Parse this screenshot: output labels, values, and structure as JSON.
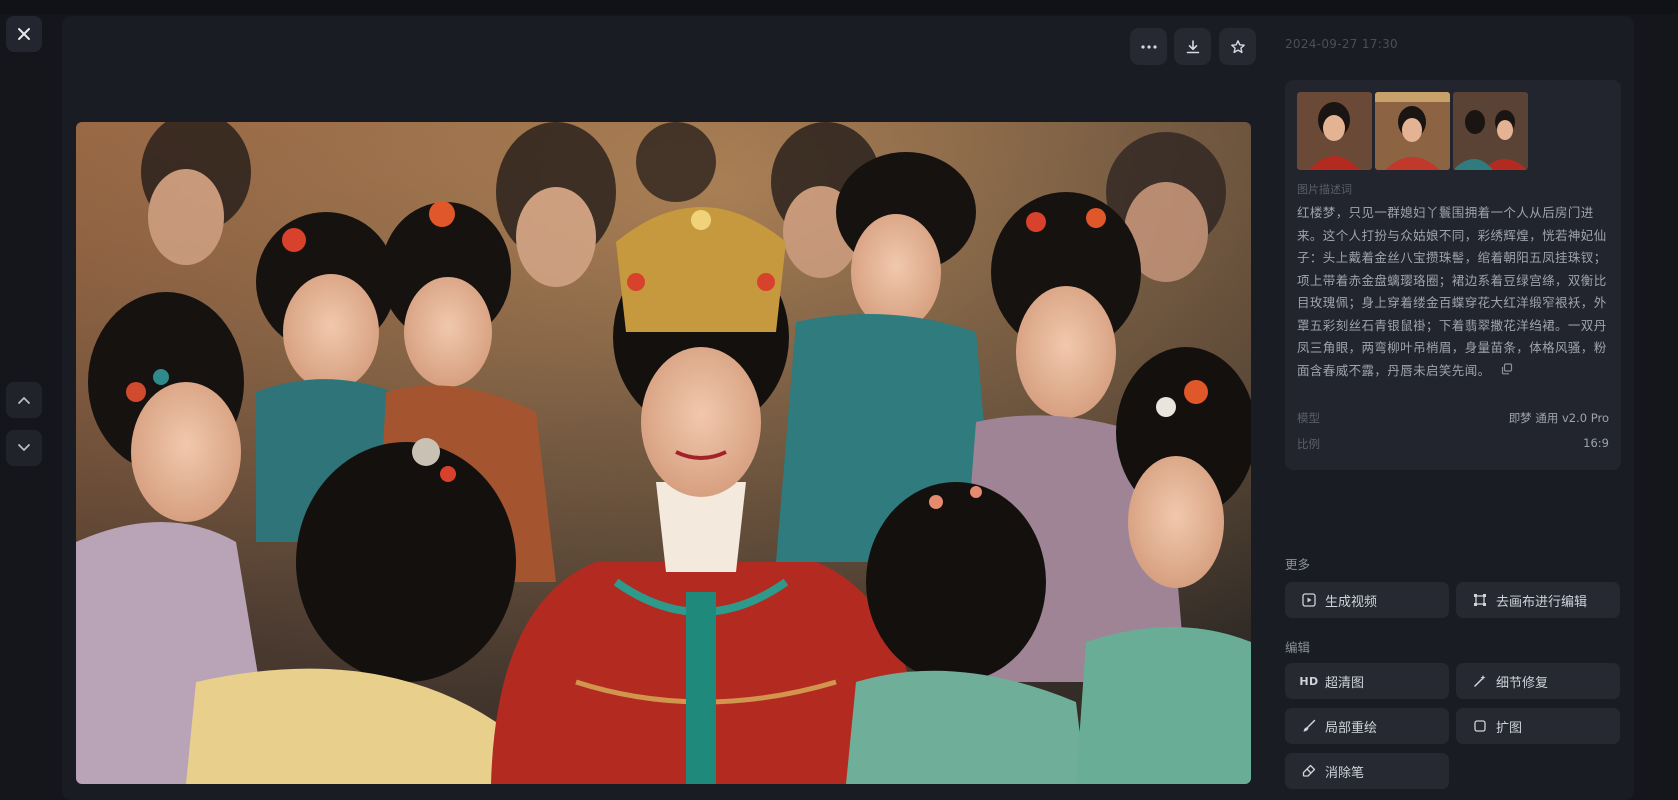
{
  "viewer": {
    "timestamp": "2024-09-27 17:30",
    "description_label": "图片描述词",
    "description": "红楼梦，只见一群媳妇丫鬟围拥着一个人从后房门进来。这个人打扮与众姑娘不同，彩绣辉煌，恍若神妃仙子：头上戴着金丝八宝攒珠髻，绾着朝阳五凤挂珠钗；项上带着赤金盘螭璎珞圈；裙边系着豆绿宫绦，双衡比目玫瑰佩；身上穿着缕金百蝶穿花大红洋缎窄裉袄，外罩五彩刻丝石青银鼠褂；下着翡翠撒花洋绉裙。一双丹凤三角眼，两弯柳叶吊梢眉，身量苗条，体格风骚，粉面含春威不露，丹唇未启笑先闻。",
    "model_label": "模型",
    "model_value": "即梦 通用 v2.0 Pro",
    "ratio_label": "比例",
    "ratio_value": "16:9"
  },
  "icons": {
    "close": "close-icon",
    "more": "more-icon",
    "download": "download-icon",
    "favorite": "star-icon",
    "prev": "chevron-up-icon",
    "next": "chevron-down-icon",
    "copy": "copy-icon"
  },
  "more_section": {
    "label": "更多",
    "generate_video": "生成视频",
    "canvas_edit": "去画布进行编辑"
  },
  "edit_section": {
    "label": "编辑",
    "hd_badge": "HD",
    "upscale": "超清图",
    "detail_fix": "细节修复",
    "inpaint": "局部重绘",
    "outpaint": "扩图",
    "eraser": "消除笔"
  }
}
